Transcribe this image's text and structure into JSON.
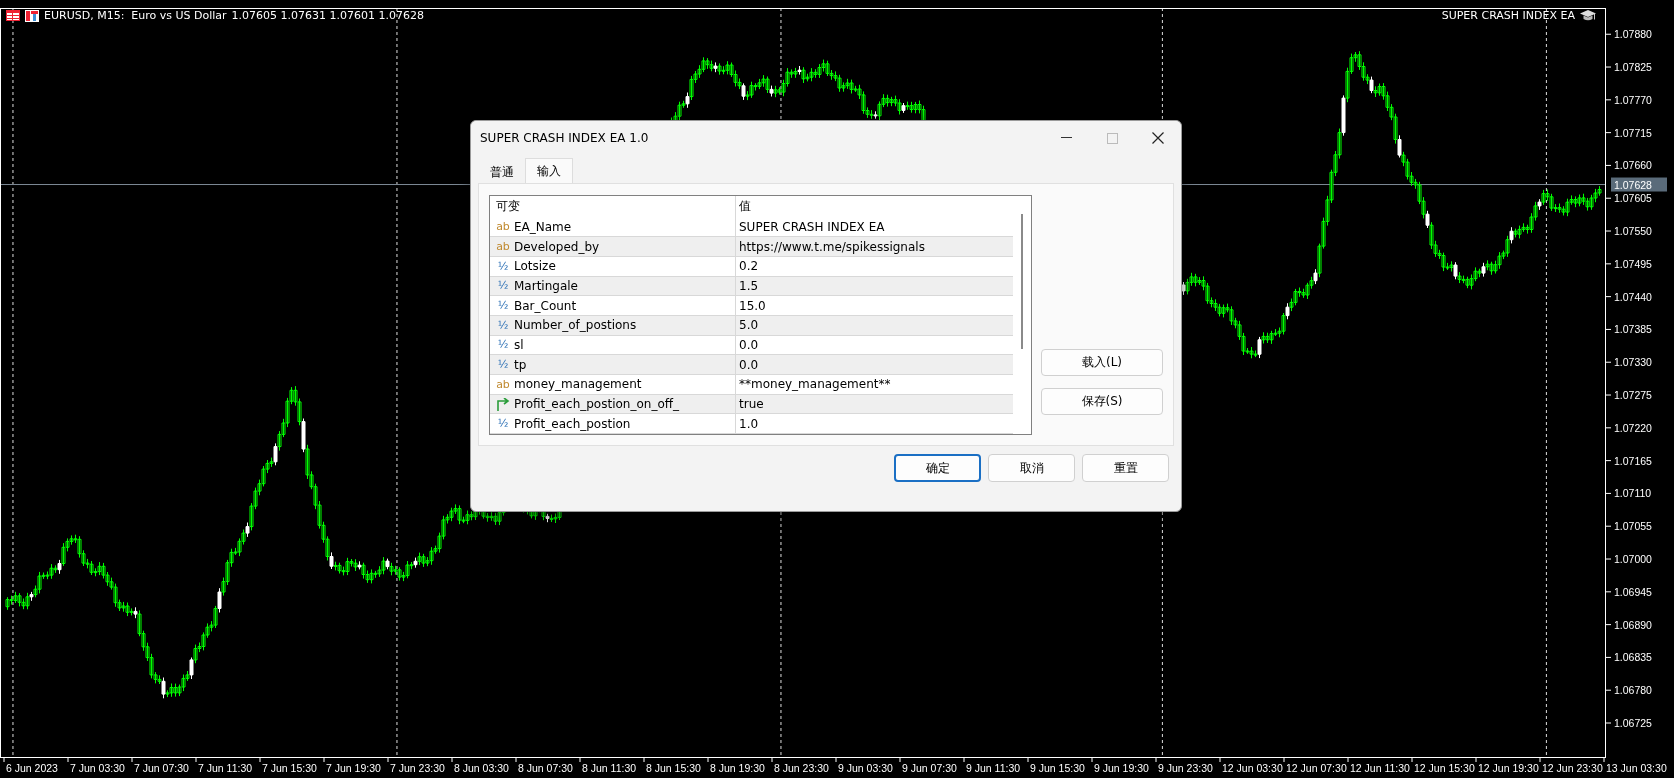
{
  "chart_header": {
    "title": "EURUSD, M15:  Euro vs US Dollar",
    "ohlc": "1.07605 1.07631 1.07601 1.07628"
  },
  "expert_label": "SUPER CRASH INDEX EA",
  "chart": {
    "current_price": "1.07628",
    "time_labels": [
      "6 Jun 2023",
      "7 Jun 03:30",
      "7 Jun 07:30",
      "7 Jun 11:30",
      "7 Jun 15:30",
      "7 Jun 19:30",
      "7 Jun 23:30",
      "8 Jun 03:30",
      "8 Jun 07:30",
      "8 Jun 11:30",
      "8 Jun 15:30",
      "8 Jun 19:30",
      "8 Jun 23:30",
      "9 Jun 03:30",
      "9 Jun 07:30",
      "9 Jun 11:30",
      "9 Jun 15:30",
      "9 Jun 19:30",
      "9 Jun 23:30",
      "12 Jun 03:30",
      "12 Jun 07:30",
      "12 Jun 11:30",
      "12 Jun 15:30",
      "12 Jun 19:30",
      "12 Jun 23:30",
      "13 Jun 03:30"
    ],
    "price_labels": [
      "1.07880",
      "1.07825",
      "1.07770",
      "1.07715",
      "1.07660",
      "1.07605",
      "1.07550",
      "1.07495",
      "1.07440",
      "1.07385",
      "1.07330",
      "1.07275",
      "1.07220",
      "1.07165",
      "1.07110",
      "1.07055",
      "1.07000",
      "1.06945",
      "1.06890",
      "1.06835",
      "1.06780",
      "1.06725"
    ]
  },
  "dialog": {
    "title": "SUPER CRASH INDEX EA 1.0",
    "tabs": [
      {
        "label": "普通",
        "selected": false
      },
      {
        "label": "输入",
        "selected": true
      }
    ],
    "table": {
      "columns": [
        "可变",
        "值"
      ],
      "rows": [
        {
          "kind": "string",
          "icon": "ab",
          "name": "EA_Name",
          "value": "SUPER CRASH INDEX EA"
        },
        {
          "kind": "string",
          "icon": "ab",
          "name": "Developed_by",
          "value": "https://www.t.me/spikessignals"
        },
        {
          "kind": "double",
          "icon": "½",
          "name": "Lotsize",
          "value": "0.2"
        },
        {
          "kind": "double",
          "icon": "½",
          "name": "Martingale",
          "value": "1.5"
        },
        {
          "kind": "double",
          "icon": "½",
          "name": "Bar_Count",
          "value": "15.0"
        },
        {
          "kind": "double",
          "icon": "½",
          "name": "Number_of_postions",
          "value": "5.0"
        },
        {
          "kind": "double",
          "icon": "½",
          "name": "sl",
          "value": "0.0"
        },
        {
          "kind": "double",
          "icon": "½",
          "name": "tp",
          "value": "0.0"
        },
        {
          "kind": "string",
          "icon": "ab",
          "name": "money_management",
          "value": "**money_management**"
        },
        {
          "kind": "bool",
          "name": "Profit_each_postion_on_off_",
          "value": "true"
        },
        {
          "kind": "double",
          "icon": "½",
          "name": "Profit_each_postion",
          "value": "1.0"
        }
      ]
    },
    "side_buttons": [
      "载入(L)",
      "保存(S)"
    ],
    "buttons": [
      {
        "label": "确定",
        "default": true
      },
      {
        "label": "取消",
        "default": false
      },
      {
        "label": "重置",
        "default": false
      }
    ]
  }
}
